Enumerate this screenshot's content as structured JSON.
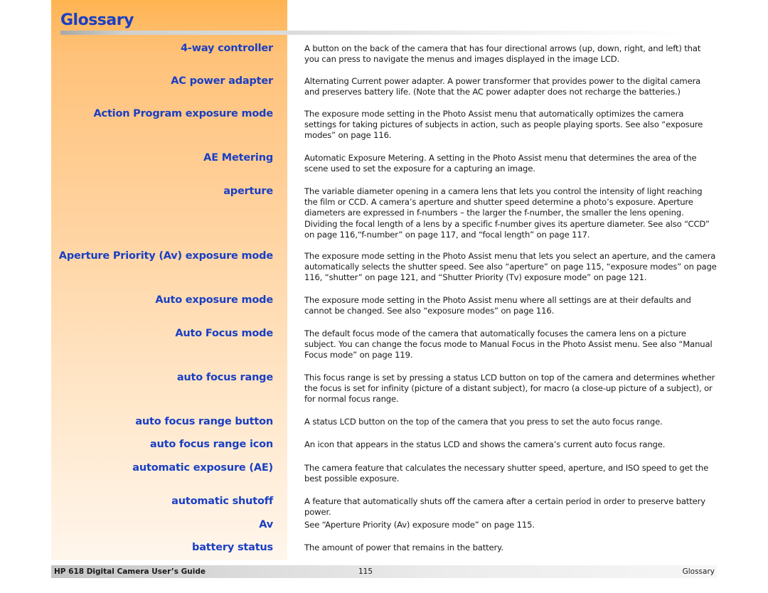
{
  "page": {
    "title": "Glossary"
  },
  "entries": [
    {
      "term": "4-way controller",
      "definition": "A button on the back of the camera that has four directional arrows (up, down, right, and left) that you can press to navigate the menus and images displayed in the image LCD."
    },
    {
      "term": "AC power adapter",
      "definition": "Alternating Current power adapter. A power transformer that provides power to the digital camera and preserves battery life. (Note that the AC power adapter does not recharge the batteries.)"
    },
    {
      "term": "Action Program exposure mode",
      "definition": "The exposure mode setting in the Photo Assist menu that automatically optimizes the camera settings for taking pictures of subjects in action, such as people playing sports. See also “exposure modes” on page 116."
    },
    {
      "term": "AE Metering",
      "definition": "Automatic Exposure Metering. A setting in the Photo Assist menu that determines the area of the scene used to set the exposure for a capturing an image."
    },
    {
      "term": "aperture",
      "definition": "The variable diameter opening in a camera lens that lets you control the intensity of light reaching the film or CCD. A camera’s aperture and shutter speed determine a photo’s exposure. Aperture diameters are expressed in f-numbers – the larger the f-number, the smaller the lens opening. Dividing the focal length of a lens by a specific f-number gives its aperture diameter. See also “CCD” on page 116,“f-number” on page 117, and “focal length” on page 117."
    },
    {
      "term": "Aperture Priority (Av) exposure mode",
      "definition": "The exposure mode setting in the Photo Assist menu that lets you select an aperture, and the camera automatically selects the shutter speed. See also “aperture” on page 115, “exposure modes” on page 116, “shutter” on page 121, and “Shutter Priority (Tv) exposure mode” on page 121."
    },
    {
      "term": "Auto exposure mode",
      "definition": "The exposure mode setting in the Photo Assist menu where all settings are at their defaults and cannot be changed. See also “exposure modes” on page 116."
    },
    {
      "term": "Auto Focus mode",
      "definition": "The default focus mode of the camera that automatically focuses the camera lens on a picture subject. You can change the focus mode to Manual Focus in the Photo Assist menu. See also “Manual Focus mode” on page 119."
    },
    {
      "term": "auto focus range",
      "definition": "This focus range is set by pressing a status LCD button on top of the camera and determines whether the focus is set for infinity (picture of a distant subject), for macro (a close-up picture of a subject), or for normal focus range."
    },
    {
      "term": "auto focus range button",
      "definition": "A status LCD button on the top of the camera that you press to set the auto focus range."
    },
    {
      "term": "auto focus range icon",
      "definition": "An icon that appears in the status LCD and shows the camera’s current auto focus range."
    },
    {
      "term": "automatic exposure (AE)",
      "definition": "The camera feature that calculates the necessary shutter speed, aperture, and ISO speed to get the best possible exposure."
    },
    {
      "term": "automatic shutoff",
      "definition": "A feature that automatically shuts off the camera after a certain period in order to preserve battery power."
    },
    {
      "term": "Av",
      "definition": "See “Aperture Priority (Av) exposure mode” on page 115."
    },
    {
      "term": "battery status",
      "definition": "The amount of power that remains in the battery."
    }
  ],
  "footer": {
    "guide_title": "HP 618 Digital Camera User’s Guide",
    "page_number": "115",
    "section": "Glossary"
  },
  "colors": {
    "accent": "#1a3fc4",
    "sidebar": "#ffc27a"
  }
}
